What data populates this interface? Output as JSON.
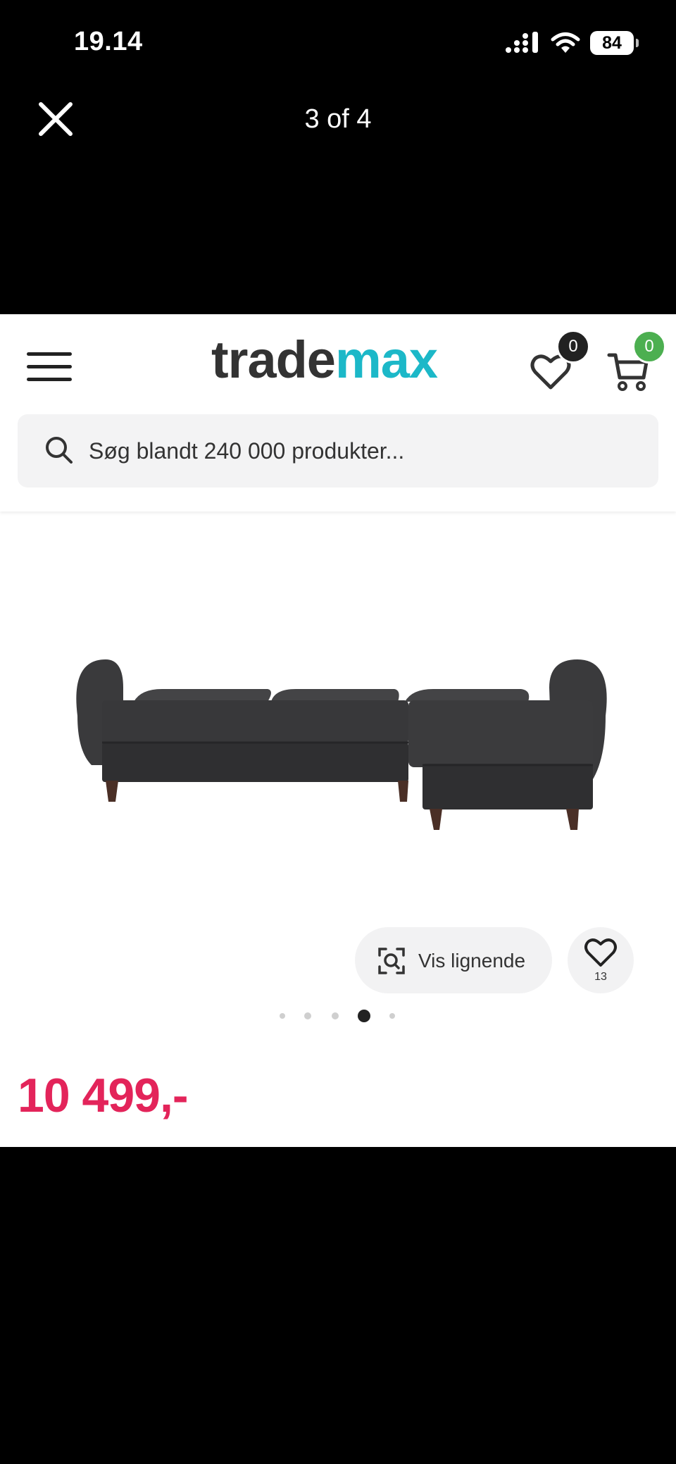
{
  "status_bar": {
    "time": "19.14",
    "battery": "84"
  },
  "viewer": {
    "counter": "3 of 4"
  },
  "site": {
    "logo_part1": "trade",
    "logo_part2": "max",
    "wishlist_count": "0",
    "cart_count": "0",
    "search_placeholder": "Søg blandt 240 000 produkter..."
  },
  "product": {
    "similar_label": "Vis lignende",
    "favorites_count": "13",
    "price": "10 499,-",
    "image_index": 3,
    "image_total": 5
  },
  "colors": {
    "brand_dark": "#333333",
    "brand_teal": "#1cb8c8",
    "price": "#e3245a",
    "cart_badge": "#4caf50"
  },
  "icons": [
    "close-icon",
    "signal-icon",
    "wifi-icon",
    "battery-icon",
    "menu-icon",
    "heart-icon",
    "cart-icon",
    "search-icon",
    "visual-search-icon"
  ]
}
